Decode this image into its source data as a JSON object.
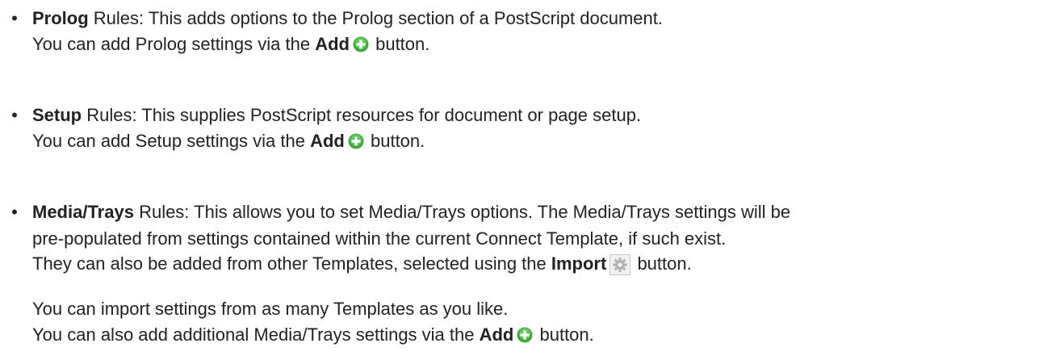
{
  "items": [
    {
      "name": "Prolog",
      "lines": [
        {
          "pre": " Rules: This adds options to the Prolog section of a PostScript document."
        },
        {
          "pre": "You can add Prolog settings via the ",
          "bold": "Add",
          "post": " button."
        }
      ]
    },
    {
      "name": "Setup",
      "lines": [
        {
          "pre": " Rules: This supplies PostScript resources for document or page setup."
        },
        {
          "pre": "You can add Setup settings via the ",
          "bold": "Add",
          "post": " button."
        }
      ]
    },
    {
      "name": "Media/Trays",
      "lines": [
        {
          "pre": " Rules: This allows you to set Media/Trays options. The Media/Trays settings will be"
        },
        {
          "pre": "pre-populated from settings contained within the current Connect Template, if such exist."
        },
        {
          "pre": "They can also be added from other Templates, selected using the ",
          "bold": "Import",
          "post": " button."
        },
        {
          "pre": "You can import settings from as many Templates as you like."
        },
        {
          "pre": "You can also add additional Media/Trays settings via the ",
          "bold": "Add",
          "post": " button."
        }
      ]
    }
  ],
  "bullet_char": "•",
  "icons": {
    "add": {
      "name": "add-plus-icon",
      "color": "#4cb848"
    },
    "import": {
      "name": "import-gear-icon",
      "color": "#b0b0b0"
    }
  }
}
